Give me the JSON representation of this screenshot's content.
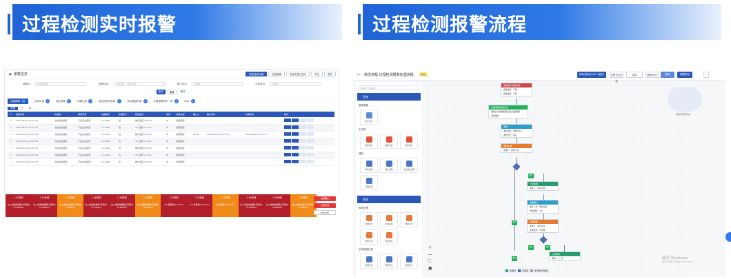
{
  "banners": {
    "left_title": "过程检测实时报警",
    "right_title": "过程检测报警流程"
  },
  "left_panel": {
    "title": "报警信息",
    "toolbar": [
      "报告检验日期",
      "批量编辑",
      "批量处理(全部)",
      "导出",
      "更多"
    ],
    "filters": [
      {
        "label": "报警ID：",
        "placeholder": "请选择报警"
      },
      {
        "label": "报警时间：",
        "placeholder": "开始日期 — 结束日期"
      },
      {
        "label": "确认状态：",
        "placeholder": "请选择"
      },
      {
        "label": "处理状态：",
        "placeholder": "请选择"
      }
    ],
    "query_buttons": {
      "search": "查询",
      "reset": "重置",
      "expand": "展开"
    },
    "tabs": [
      {
        "label": "全部报警",
        "count": "75"
      },
      {
        "label": "总实时报",
        "count": "1"
      },
      {
        "label": "待处理报",
        "count": "1"
      },
      {
        "label": "待确认报",
        "count": "4"
      },
      {
        "label": "超过报告时效报",
        "count": "4"
      },
      {
        "label": "待处理超时报",
        "count": "1"
      },
      {
        "label": "关键报警停不一致",
        "count": "1"
      },
      {
        "label": "BAX",
        "count": "1"
      }
    ],
    "sub_tabs": [
      "全部",
      "已",
      "未"
    ],
    "columns": [
      "报警时间",
      "检验类",
      "报警来源",
      "设备编号",
      "处理部门",
      "报警描述",
      "级别",
      "报警类型",
      "确认人",
      "确认时间",
      "处理时间",
      "操作"
    ],
    "rows": [
      {
        "time": "2024-06-05 10:57:05",
        "cat": "在线巡检报警",
        "src": "产品出站报警",
        "dev": "LC-0000",
        "dept": "班",
        "desc": "物料温度 26.97℃",
        "lvl": "中",
        "type": "超限报警",
        "who": "",
        "ct": "",
        "pt": ""
      },
      {
        "time": "2024-06-05 10:57:05",
        "cat": "在线巡检报警",
        "src": "产品出站报警",
        "dev": "LC-0000",
        "dept": "班",
        "desc": "V2 流量 52.17%",
        "lvl": "中",
        "type": "超限报警",
        "who": "",
        "ct": "",
        "pt": ""
      },
      {
        "time": "2024-06-05 10:57:05",
        "cat": "在线巡检报警",
        "src": "产品出站报警",
        "dev": "LC-0000",
        "dept": "班",
        "desc": "物料温度 26.97℃",
        "lvl": "中",
        "type": "超限报警",
        "who": "admin",
        "ct": "2024-06-05 10:57:02",
        "pt": "2024-06-05 10:57:17"
      },
      {
        "time": "2024-06-05 10:55:45",
        "cat": "在线巡检报警",
        "src": "产品出站报警",
        "dev": "LC-0000",
        "dept": "班",
        "desc": "V2 流量 52.17%",
        "lvl": "中",
        "type": "超限报警",
        "who": "",
        "ct": "",
        "pt": ""
      },
      {
        "time": "2024-06-05 10:55:45",
        "cat": "在线巡检报警",
        "src": "产品出站报警",
        "dev": "LC-0000",
        "dept": "班",
        "desc": "物料温度 26.97℃",
        "lvl": "中",
        "type": "超限报警",
        "who": "",
        "ct": "",
        "pt": ""
      },
      {
        "time": "2024-06-05 10:55:45",
        "cat": "在线巡检报警",
        "src": "产品出站报警",
        "dev": "LC-0000",
        "dept": "班",
        "desc": "V2 流量 52.17%",
        "lvl": "中",
        "type": "超限报警",
        "who": "",
        "ct": "",
        "pt": ""
      },
      {
        "time": "2024-06-05 10:55:45",
        "cat": "在线巡检报警",
        "src": "产品出站报警",
        "dev": "LC-0000",
        "dept": "班",
        "desc": "物料温度 26.97℃",
        "lvl": "中",
        "type": "超限报警",
        "who": "",
        "ct": "",
        "pt": ""
      }
    ],
    "alarms": [
      {
        "n": "2 分钟前",
        "t": "过入检验前报警(已延时)(2.69Kpa)",
        "c": "red"
      },
      {
        "n": "2 分钟前",
        "t": "过入检验前报警(已延时)(2.69Kpa)",
        "c": "red"
      },
      {
        "n": "2 分钟前",
        "t": "过入检验前报警(已延时)(2.69Kpa)",
        "c": "org"
      },
      {
        "n": "2 分钟前",
        "t": "过入检验前报警(已延时)(2.69Kpa)",
        "c": "red"
      },
      {
        "n": "2 分钟前",
        "t": "过入检验前报警(已延时)(2.69Kpa)",
        "c": "red"
      },
      {
        "n": "2 分钟前",
        "t": "过入检验前报警(已延时)(2.69Kpa)",
        "c": "org"
      },
      {
        "n": "2 分钟前",
        "t": "V2 流量值(52.17%)",
        "c": "red"
      },
      {
        "n": "2 分钟前",
        "t": "V2 流量值(52.17%)",
        "c": "red"
      },
      {
        "n": "2 分钟前",
        "t": "物料温度(26.97℃)",
        "c": "org"
      },
      {
        "n": "2 分钟前",
        "t": "过入检验前报警(已延时)(2.69Kpa)",
        "c": "red"
      },
      {
        "n": "2 分钟前",
        "t": "过入检验前报警(已延时)(2.69Kpa)",
        "c": "red"
      },
      {
        "n": "2 分钟前",
        "t": "过入检验前报警(已延时)(2.69Kpa)",
        "c": "org"
      }
    ],
    "side_buttons": [
      "全部确认",
      "全部处理",
      "前往详情"
    ]
  },
  "right_panel": {
    "back": "←",
    "title": "修改流程 过程检测报警处理流程",
    "tag": "测试",
    "toolbar": [
      "移动/拖动(Shift+鼠标)",
      "全屏节点可视",
      "选择",
      "撤销/执行",
      "保存",
      "部署发布",
      "···"
    ],
    "search_placeholder": "请输入节点名称",
    "section_start": "开始",
    "section_end": "处理",
    "cat_basic": "基础要素",
    "cat_main": "主流程",
    "cat_notify": "通知",
    "cat_handle": "审批处理",
    "cat_data": "全局数据处理",
    "nodes_basic": [
      "用户节点"
    ],
    "nodes_main": [
      "报警事件",
      "报警内容",
      "延迟事件"
    ],
    "nodes_notify": [
      "邮件通知",
      "短信通知",
      "企业微信通知",
      "流程审批"
    ],
    "nodes_handle": [
      "处理记录",
      "处理流程",
      "数据记录",
      "报告记录",
      "更改报告"
    ],
    "nodes_data": [
      "数据记录",
      "数据导出",
      "数据统计"
    ],
    "flow": [
      {
        "h": "报警事件/报警条件",
        "r": [
          "报警类型：不限",
          "报警级别：不限"
        ],
        "c": "#c94a4a"
      },
      {
        "h": "处理流程/报警信息",
        "r": [
          "报警信息 数据处理 温度/湿度数据",
          "对应措施"
        ],
        "c": "#22b05a"
      },
      {
        "h": "通知",
        "r": [
          "通知对象：报警负责人",
          "通知方式：短信"
        ],
        "c": "#2d9ec9"
      },
      {
        "h": "审批处理",
        "r": [
          "处理人：报警人员"
        ],
        "c": "#e47b2e"
      },
      {
        "h": "二级审批",
        "r": [
          "审批人：车间主任"
        ],
        "c": "#2a9d6f"
      },
      {
        "h": "报警确认",
        "r": [
          "确认人员：质检主管",
          "处理期限：24h"
        ],
        "c": "#2d9ec9"
      },
      {
        "h": "处理结果",
        "r": [
          "处理人：车间主任",
          "处理结果：已处理"
        ],
        "c": "#e47b2e"
      },
      {
        "h": "三级审批",
        "r": [
          "审批人：厂长"
        ],
        "c": "#2a9d6f"
      }
    ],
    "branch_labels": [
      "通过",
      "驳回",
      "通过",
      "驳回",
      "通过"
    ],
    "zoom": [
      "+",
      "—",
      "⛶",
      "▣"
    ],
    "legend": [
      "处理中",
      "已完成",
      "未开始/待处理"
    ],
    "cloud_label": "添加开始节点",
    "watermark": "激活 Windows",
    "watermark_sub": "转到\"设置\"以激活 Windows。"
  }
}
